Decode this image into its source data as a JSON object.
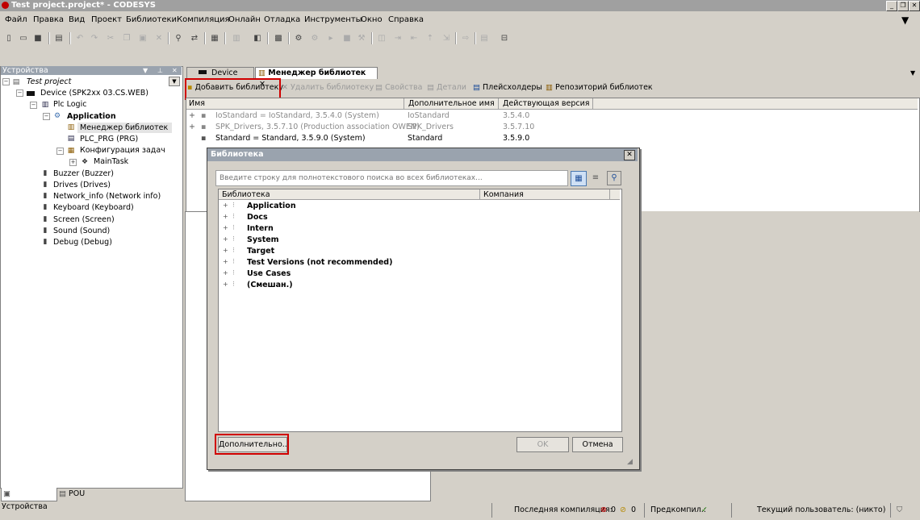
{
  "window": {
    "title": "Test project.project* - CODESYS"
  },
  "menu": [
    "Файл",
    "Правка",
    "Вид",
    "Проект",
    "Библиотеки",
    "Компиляция",
    "Онлайн",
    "Отладка",
    "Инструменты",
    "Окно",
    "Справка"
  ],
  "devices_panel": {
    "title": "Устройства",
    "tree": [
      {
        "label": "Test project",
        "icon": "project-icon"
      },
      {
        "label": "Device (SPK2xx 03.CS.WEB)",
        "icon": "device-icon"
      },
      {
        "label": "Plc Logic",
        "icon": "plc-logic-icon"
      },
      {
        "label": "Application",
        "icon": "application-icon"
      },
      {
        "label": "Менеджер библиотек",
        "icon": "library-manager-icon"
      },
      {
        "label": "PLC_PRG (PRG)",
        "icon": "pou-icon"
      },
      {
        "label": "Конфигурация задач",
        "icon": "task-config-icon"
      },
      {
        "label": "MainTask",
        "icon": "task-icon"
      },
      {
        "label": "Buzzer (Buzzer)",
        "icon": "module-icon"
      },
      {
        "label": "Drives (Drives)",
        "icon": "module-icon"
      },
      {
        "label": "Network_info (Network info)",
        "icon": "module-icon"
      },
      {
        "label": "Keyboard (Keyboard)",
        "icon": "module-icon"
      },
      {
        "label": "Screen (Screen)",
        "icon": "module-icon"
      },
      {
        "label": "Sound (Sound)",
        "icon": "module-icon"
      },
      {
        "label": "Debug (Debug)",
        "icon": "module-icon"
      }
    ],
    "bottom_tabs": [
      "Устройства",
      "POU"
    ]
  },
  "editor": {
    "tabs": [
      "Device",
      "Менеджер библиотек"
    ],
    "toolbar": {
      "add_library": "Добавить библиотеку",
      "delete_library": "Удалить библиотеку",
      "properties": "Свойства",
      "details": "Детали",
      "placeholders": "Плейсхолдеры",
      "repository": "Репозиторий библиотек"
    },
    "columns": [
      "Имя",
      "Дополнительное имя",
      "Действующая версия"
    ],
    "rows": [
      {
        "name": "IoStandard = IoStandard, 3.5.4.0 (System)",
        "alias": "IoStandard",
        "version": "3.5.4.0",
        "grey": true
      },
      {
        "name": "SPK_Drivers, 3.5.7.10 (Production association OWEN)",
        "alias": "SPK_Drivers",
        "version": "3.5.7.10",
        "grey": true
      },
      {
        "name": "Standard = Standard, 3.5.9.0 (System)",
        "alias": "Standard",
        "version": "3.5.9.0",
        "grey": false
      }
    ]
  },
  "dialog": {
    "title": "Библиотека",
    "search_placeholder": "Введите строку для полнотекстового поиска во всех библиотеках...",
    "columns": [
      "Библиотека",
      "Компания"
    ],
    "categories": [
      "Application",
      "Docs",
      "Intern",
      "System",
      "Target",
      "Test Versions (not recommended)",
      "Use Cases",
      "(Смешан.)"
    ],
    "advanced_button": "Дополнительно...",
    "ok_button": "OK",
    "cancel_button": "Отмена"
  },
  "statusbar": {
    "last_compile": "Последняя компиляция:",
    "errors": "0",
    "warnings": "0",
    "precompile": "Предкомпил.:",
    "current_user": "Текущий пользователь: (никто)"
  },
  "colors": {
    "highlight": "#d00000",
    "panel_header": "#9aa3ae"
  }
}
